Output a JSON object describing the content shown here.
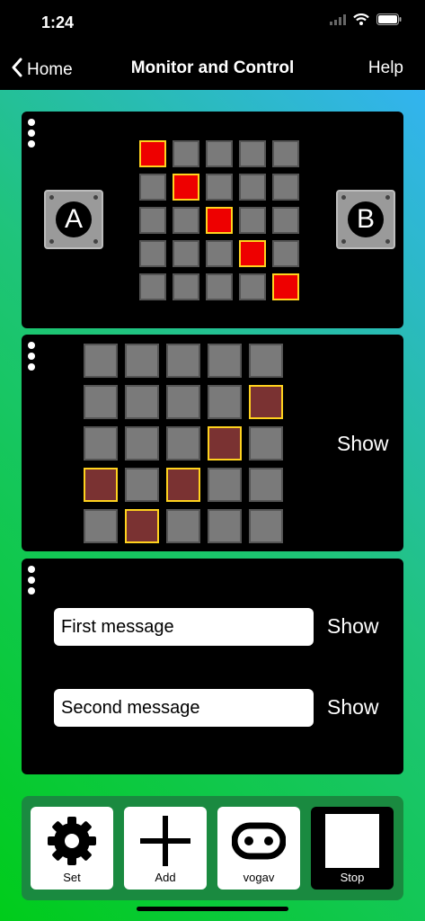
{
  "status": {
    "time": "1:24"
  },
  "nav": {
    "back_label": "Home",
    "title": "Monitor and Control",
    "help_label": "Help"
  },
  "panel1": {
    "button_a": "A",
    "button_b": "B",
    "led_matrix": [
      [
        1,
        0,
        0,
        0,
        0
      ],
      [
        0,
        1,
        0,
        0,
        0
      ],
      [
        0,
        0,
        1,
        0,
        0
      ],
      [
        0,
        0,
        0,
        1,
        0
      ],
      [
        0,
        0,
        0,
        0,
        1
      ]
    ]
  },
  "panel2": {
    "show_label": "Show",
    "edit_matrix": [
      [
        0,
        0,
        0,
        0,
        0
      ],
      [
        0,
        0,
        0,
        0,
        1
      ],
      [
        0,
        0,
        0,
        1,
        0
      ],
      [
        1,
        0,
        1,
        0,
        0
      ],
      [
        0,
        1,
        0,
        0,
        0
      ]
    ]
  },
  "panel3": {
    "messages": [
      {
        "value": "First message",
        "show_label": "Show"
      },
      {
        "value": "Second message",
        "show_label": "Show"
      }
    ]
  },
  "toolbar": {
    "set_label": "Set",
    "add_label": "Add",
    "device_label": "vogav",
    "stop_label": "Stop"
  },
  "colors": {
    "led_on": "#ee0000",
    "edit_on": "#7a3232",
    "highlight_border": "#ffd21e",
    "toolbar_bg": "#1a8a40"
  }
}
